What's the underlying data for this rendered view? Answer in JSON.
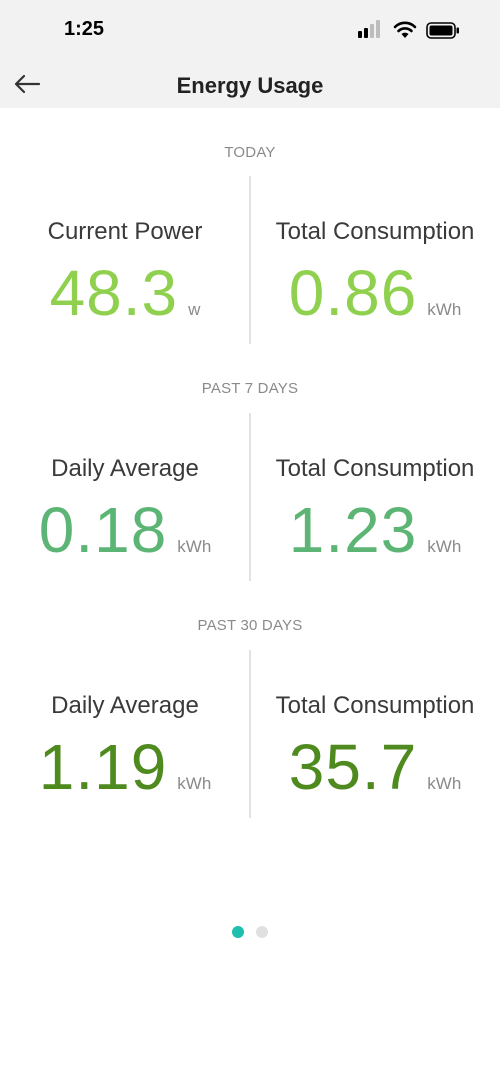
{
  "status_bar": {
    "time": "1:25"
  },
  "nav": {
    "title": "Energy Usage"
  },
  "colors": {
    "today": "#8fd14f",
    "week": "#5cb574",
    "month": "#4f8a1f",
    "pager_active": "#1fbfae",
    "pager_inactive": "#e0e0e0"
  },
  "sections": [
    {
      "header": "TODAY",
      "left": {
        "label": "Current Power",
        "value": "48.3",
        "unit": "w"
      },
      "right": {
        "label": "Total Consumption",
        "value": "0.86",
        "unit": "kWh"
      }
    },
    {
      "header": "PAST 7 DAYS",
      "left": {
        "label": "Daily Average",
        "value": "0.18",
        "unit": "kWh"
      },
      "right": {
        "label": "Total Consumption",
        "value": "1.23",
        "unit": "kWh"
      }
    },
    {
      "header": "PAST 30 DAYS",
      "left": {
        "label": "Daily Average",
        "value": "1.19",
        "unit": "kWh"
      },
      "right": {
        "label": "Total Consumption",
        "value": "35.7",
        "unit": "kWh"
      }
    }
  ],
  "pager": {
    "pages": 2,
    "active": 0
  },
  "icons": {
    "back": "arrow-left-icon",
    "signal": "cellular-signal-icon",
    "wifi": "wifi-icon",
    "battery": "battery-icon"
  }
}
